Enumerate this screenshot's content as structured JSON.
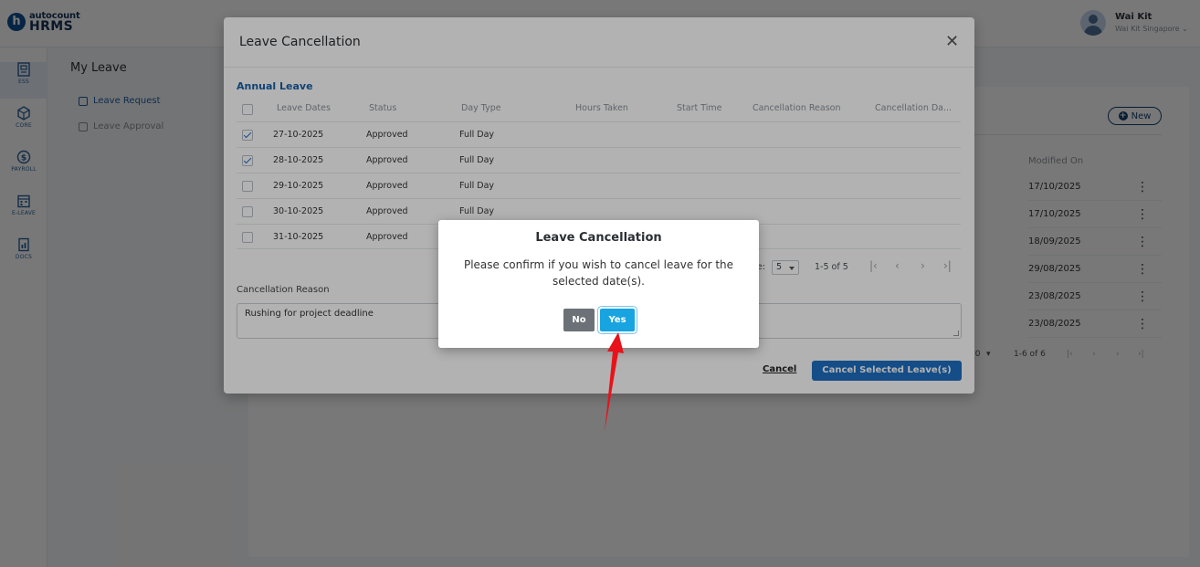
{
  "app": {
    "logo_small": "autocount",
    "logo_big": "HRMS",
    "logo_letter": "h"
  },
  "user": {
    "name": "Wai Kit",
    "company": "Wai Kit Singapore ⌄"
  },
  "nav": [
    {
      "label": "ESS",
      "icon": "ess-icon"
    },
    {
      "label": "CORE",
      "icon": "core-icon"
    },
    {
      "label": "PAYROLL",
      "icon": "payroll-icon"
    },
    {
      "label": "E-LEAVE",
      "icon": "eleave-icon"
    },
    {
      "label": "DOCS",
      "icon": "docs-icon"
    }
  ],
  "page": {
    "title": "My Leave",
    "sub_links": [
      "Leave Request",
      "Leave Approval"
    ]
  },
  "background_card": {
    "new_label": "New",
    "modified_header": "Modified On",
    "modified_dates": [
      "17/10/2025",
      "17/10/2025",
      "18/09/2025",
      "29/08/2025",
      "23/08/2025",
      "23/08/2025"
    ],
    "pager_size": "10",
    "pager_range": "1-6 of 6"
  },
  "dialog": {
    "title": "Leave Cancellation",
    "section": "Annual Leave",
    "columns": [
      "Leave Dates",
      "Status",
      "Day Type",
      "Hours Taken",
      "Start Time",
      "Cancellation Reason",
      "Cancellation Da..."
    ],
    "rows": [
      {
        "date": "27-10-2025",
        "status": "Approved",
        "day_type": "Full Day",
        "checked": true
      },
      {
        "date": "28-10-2025",
        "status": "Approved",
        "day_type": "Full Day",
        "checked": true
      },
      {
        "date": "29-10-2025",
        "status": "Approved",
        "day_type": "Full Day",
        "checked": false
      },
      {
        "date": "30-10-2025",
        "status": "Approved",
        "day_type": "Full Day",
        "checked": false
      },
      {
        "date": "31-10-2025",
        "status": "Approved",
        "day_type": "",
        "checked": false
      }
    ],
    "pager_label": "e:",
    "pager_size": "5",
    "pager_range": "1-5 of 5",
    "reason_label": "Cancellation Reason",
    "reason_value": "Rushing for project deadline",
    "cancel_link": "Cancel",
    "cancel_selected": "Cancel Selected Leave(s)"
  },
  "confirm": {
    "title": "Leave Cancellation",
    "message": "Please confirm if you wish to cancel leave for the selected date(s).",
    "no_label": "No",
    "yes_label": "Yes"
  },
  "colors": {
    "brand": "#0e4e91",
    "primary_button": "#1e6fc2",
    "yes_button": "#18a4e0",
    "no_button": "#6b7177",
    "annotation_arrow": "#e8121a"
  }
}
